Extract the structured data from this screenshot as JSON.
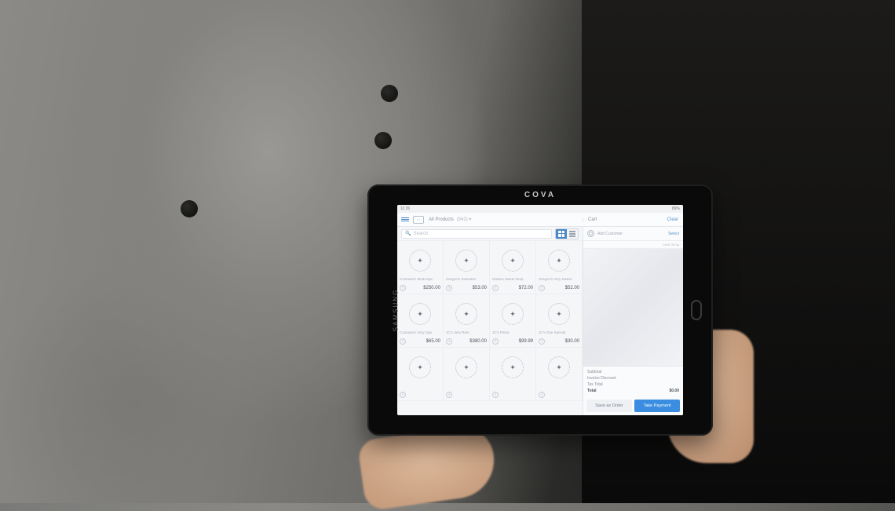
{
  "device": {
    "brand": "COVA",
    "maker": "SAMSUNG"
  },
  "status": {
    "time": "11:26",
    "battery": "89%"
  },
  "header": {
    "title": "All Products",
    "count": "(942)",
    "cart_label": "Cart",
    "clear_label": "Clear"
  },
  "search": {
    "placeholder": "Search"
  },
  "view": {
    "grid_label": "grid",
    "list_label": "list"
  },
  "products": [
    {
      "name": "Colorado's Multi-Spa",
      "price": "$250.00"
    },
    {
      "name": "Oregon's Sweetest",
      "price": "$53.00"
    },
    {
      "name": "Ontario Sweet Drop",
      "price": "$72.00"
    },
    {
      "name": "Oregon's Very Sweet",
      "price": "$52.00"
    },
    {
      "name": "Colorado's Very Spa",
      "price": "$65.00"
    },
    {
      "name": "JC's Very Rare",
      "price": "$380.00"
    },
    {
      "name": "JC's Prime",
      "price": "$99.99"
    },
    {
      "name": "JC's One Special",
      "price": "$30.00"
    },
    {
      "name": "",
      "price": ""
    },
    {
      "name": "",
      "price": ""
    },
    {
      "name": "",
      "price": ""
    },
    {
      "name": "",
      "price": ""
    }
  ],
  "cart": {
    "customer_placeholder": "Add Customer",
    "customer_action": "Select",
    "limit_text": "Limit: 28.0g",
    "subtotal_label": "Subtotal",
    "discount_label": "Invoice Discount",
    "tax_label": "Tax Total",
    "total_label": "Total",
    "subtotal": "",
    "discount": "",
    "tax": "",
    "total": "$0.00",
    "save_order_label": "Save as Order",
    "pay_label": "Take Payment"
  },
  "icons": {
    "menu": "menu",
    "search": "search",
    "grid": "grid",
    "list": "list",
    "info": "i",
    "leaf": "✦",
    "person": "person"
  }
}
